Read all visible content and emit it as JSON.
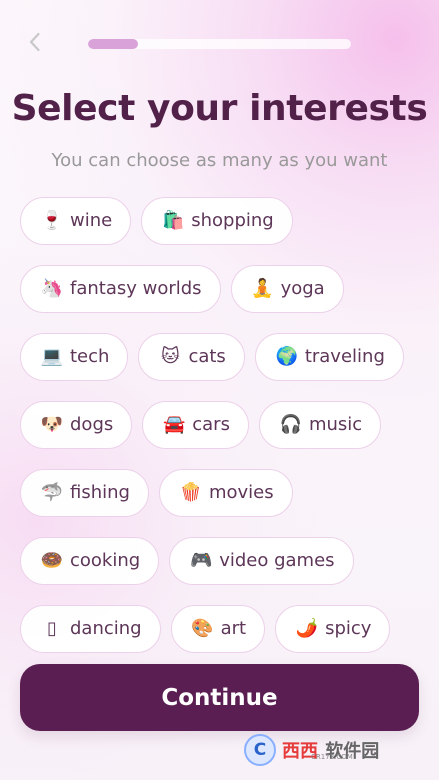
{
  "progress": {
    "value": 0.19
  },
  "header": {
    "title": "Select your interests",
    "subtitle": "You can choose as many as you want"
  },
  "interests": [
    [
      {
        "icon": "🍷",
        "label": "wine",
        "icon_name": "wine-icon"
      },
      {
        "icon": "🛍️",
        "label": "shopping",
        "icon_name": "shopping-bag-icon"
      }
    ],
    [
      {
        "icon": "🦄",
        "label": "fantasy worlds",
        "icon_name": "unicorn-icon"
      },
      {
        "icon": "🧘",
        "label": "yoga",
        "icon_name": "yoga-icon"
      }
    ],
    [
      {
        "icon": "💻",
        "label": "tech",
        "icon_name": "laptop-icon"
      },
      {
        "icon": "🐱",
        "label": "cats",
        "icon_name": "cat-icon"
      },
      {
        "icon": "🌍",
        "label": "traveling",
        "icon_name": "globe-icon"
      }
    ],
    [
      {
        "icon": "🐶",
        "label": "dogs",
        "icon_name": "dog-icon"
      },
      {
        "icon": "🚘",
        "label": "cars",
        "icon_name": "car-icon"
      },
      {
        "icon": "🎧",
        "label": "music",
        "icon_name": "headphones-icon"
      }
    ],
    [
      {
        "icon": "🦈",
        "label": "fishing",
        "icon_name": "shark-icon"
      },
      {
        "icon": "🍿",
        "label": "movies",
        "icon_name": "popcorn-icon"
      }
    ],
    [
      {
        "icon": "🍩",
        "label": "cooking",
        "icon_name": "donut-icon"
      },
      {
        "icon": "🎮",
        "label": "video games",
        "icon_name": "gamepad-icon"
      }
    ],
    [
      {
        "icon": "▯",
        "label": "dancing",
        "icon_name": "missing-glyph-icon"
      },
      {
        "icon": "🎨",
        "label": "art",
        "icon_name": "palette-icon"
      },
      {
        "icon": "🌶️",
        "label": "spicy",
        "icon_name": "chili-icon"
      }
    ]
  ],
  "footer": {
    "continue_label": "Continue"
  },
  "watermark": {
    "letter": "C",
    "red_text": "西西",
    "gray_text": "软件园",
    "small_text": "CR173.COM"
  }
}
